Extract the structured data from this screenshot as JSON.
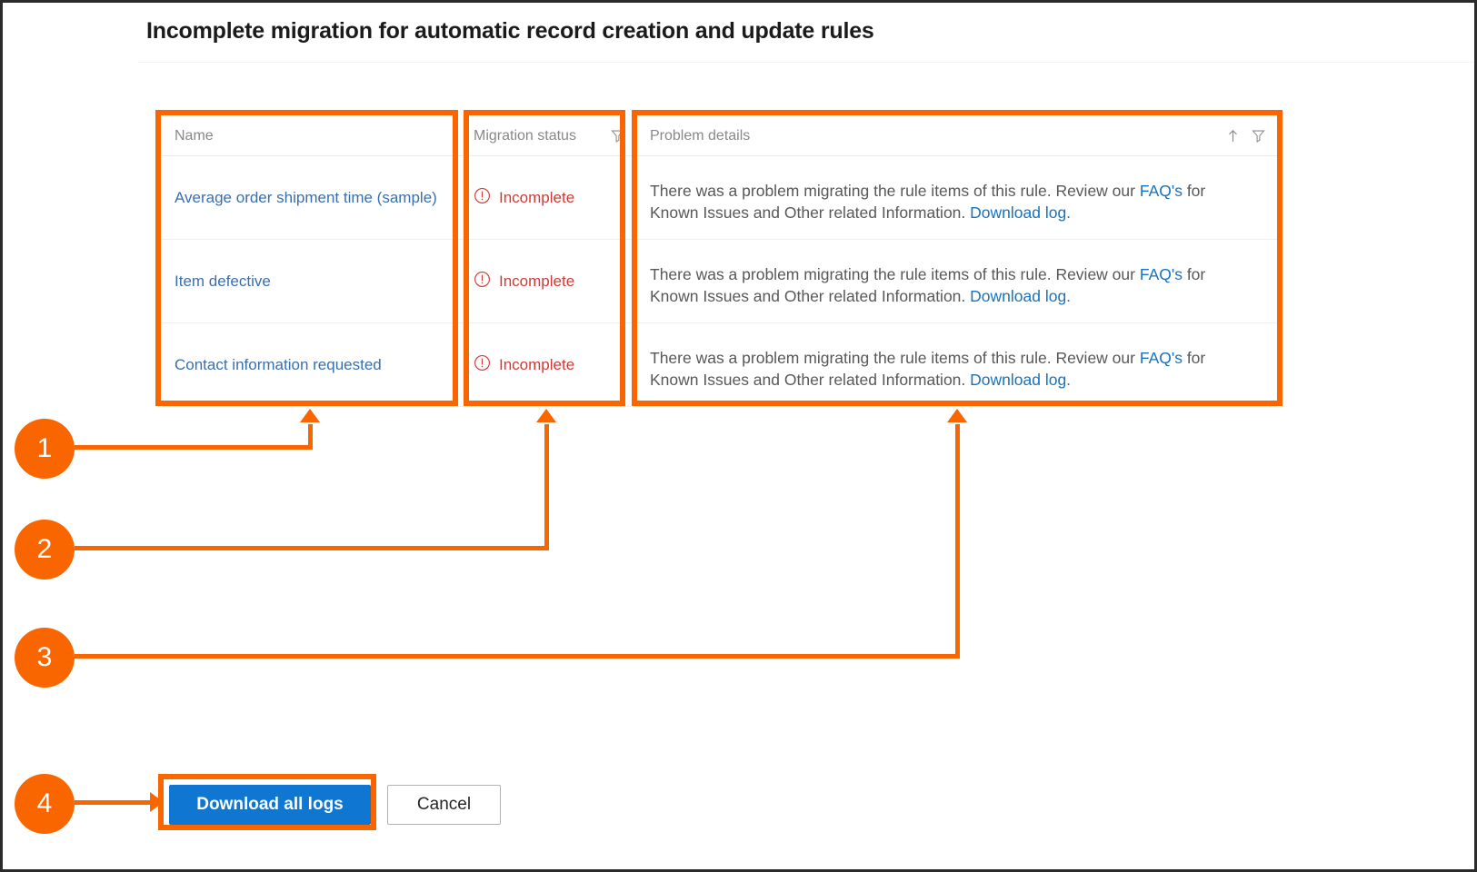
{
  "dialog": {
    "title": "Incomplete migration for automatic record creation and update rules"
  },
  "grid": {
    "columns": [
      {
        "key": "name",
        "label": "Name",
        "filter": false,
        "sort": false
      },
      {
        "key": "status",
        "label": "Migration status",
        "filter": true,
        "sort": false
      },
      {
        "key": "problem",
        "label": "Problem details",
        "filter": true,
        "sort": true
      }
    ],
    "rows": [
      {
        "name": "Average order shipment time (sample)",
        "status": "Incomplete",
        "status_icon": "error-circle-icon",
        "problem_text_1": "There was a problem migrating the rule items of this rule. Review our ",
        "problem_link_faq": "FAQ's",
        "problem_text_2": " for Known Issues and Other related Information. ",
        "problem_link_log": "Download log."
      },
      {
        "name": "Item defective",
        "status": "Incomplete",
        "status_icon": "error-circle-icon",
        "problem_text_1": "There was a problem migrating the rule items of this rule. Review our ",
        "problem_link_faq": "FAQ's",
        "problem_text_2": " for Known Issues and Other related Information. ",
        "problem_link_log": "Download log."
      },
      {
        "name": "Contact information requested",
        "status": "Incomplete",
        "status_icon": "error-circle-icon",
        "problem_text_1": "There was a problem migrating the rule items of this rule. Review our ",
        "problem_link_faq": "FAQ's",
        "problem_text_2": " for Known Issues and Other related Information. ",
        "problem_link_log": "Download log."
      }
    ]
  },
  "footer": {
    "primary_label": "Download all logs",
    "secondary_label": "Cancel"
  },
  "callouts": [
    {
      "number": "1",
      "target": "name-column"
    },
    {
      "number": "2",
      "target": "migration-status-column"
    },
    {
      "number": "3",
      "target": "problem-details-column"
    },
    {
      "number": "4",
      "target": "download-all-logs-button"
    }
  ],
  "colors": {
    "annotation_orange": "#F96600",
    "primary_button_blue": "#0F77D1",
    "link_blue": "#1673C1",
    "name_link_blue": "#3A6FAE",
    "error_red": "#D03A36",
    "header_text_gray": "#8A8886",
    "body_text_gray": "#585858"
  }
}
